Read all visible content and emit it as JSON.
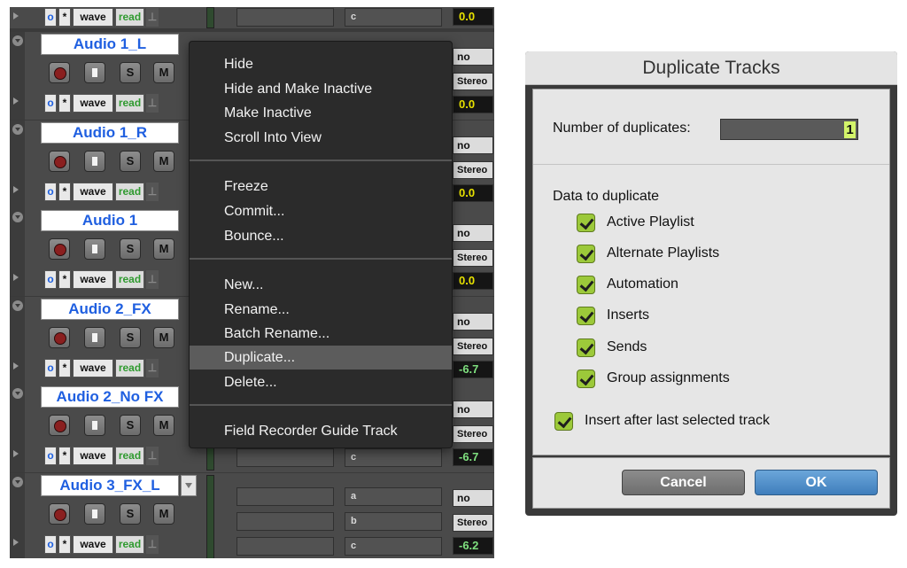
{
  "tracks": [
    {
      "name": "Audio 1_L",
      "rec": "",
      "input": "I",
      "solo": "S",
      "mute": "M",
      "voice": "wave",
      "auto": "read",
      "panel_btn": "no",
      "panel_out": "Stereo",
      "volume": "0.0"
    },
    {
      "name": "Audio 1_R",
      "rec": "",
      "input": "I",
      "solo": "S",
      "mute": "M",
      "voice": "wave",
      "auto": "read",
      "panel_btn": "no",
      "panel_out": "Stereo",
      "volume": "0.0"
    },
    {
      "name": "Audio 1",
      "rec": "",
      "input": "I",
      "solo": "S",
      "mute": "M",
      "voice": "wave",
      "auto": "read",
      "panel_btn": "no",
      "panel_out": "Stereo",
      "volume": "0.0"
    },
    {
      "name": "Audio 2_FX",
      "rec": "",
      "input": "I",
      "solo": "S",
      "mute": "M",
      "voice": "wave",
      "auto": "read",
      "panel_btn": "no",
      "panel_out": "Stereo",
      "volume": "-6.7"
    },
    {
      "name": "Audio 2_No FX",
      "rec": "",
      "input": "I",
      "solo": "S",
      "mute": "M",
      "voice": "wave",
      "auto": "read",
      "panel_btn": "no",
      "panel_out": "Stereo",
      "volume": "-6.7"
    },
    {
      "name": "Audio 3_FX_L",
      "rec": "",
      "input": "I",
      "solo": "S",
      "mute": "M",
      "voice": "wave",
      "auto": "read",
      "panel_btn": "no",
      "panel_out": "Stereo",
      "volume": "-6.2"
    }
  ],
  "top_partial": {
    "voice": "wave",
    "auto": "read",
    "field": "c",
    "volume": "0.0"
  },
  "insert_letters": {
    "a": "a",
    "b": "b",
    "c": "c"
  },
  "context_menu": {
    "group1": [
      "Hide",
      "Hide and Make Inactive",
      "Make Inactive",
      "Scroll Into View"
    ],
    "group2": [
      "Freeze",
      "Commit...",
      "Bounce..."
    ],
    "group3": [
      "New...",
      "Rename...",
      "Batch Rename...",
      "Duplicate...",
      "Delete..."
    ],
    "group4": [
      "Field Recorder Guide Track"
    ],
    "highlighted": "Duplicate..."
  },
  "dialog": {
    "title": "Duplicate Tracks",
    "number_label": "Number of duplicates:",
    "number_value": "1",
    "data_label": "Data to duplicate",
    "options": [
      {
        "label": "Active Playlist",
        "checked": true
      },
      {
        "label": "Alternate Playlists",
        "checked": true
      },
      {
        "label": "Automation",
        "checked": true
      },
      {
        "label": "Inserts",
        "checked": true
      },
      {
        "label": "Sends",
        "checked": true
      },
      {
        "label": "Group assignments",
        "checked": true
      }
    ],
    "insert_after_label": "Insert after last selected track",
    "insert_after_checked": true,
    "cancel_label": "Cancel",
    "ok_label": "OK"
  },
  "colors": {
    "track_name": "#1f5fe0",
    "read_green": "#2f9a2f",
    "check_green": "#9cc93a",
    "ok_blue": "#3f7ebc",
    "volume_yellow": "#e8e200"
  }
}
